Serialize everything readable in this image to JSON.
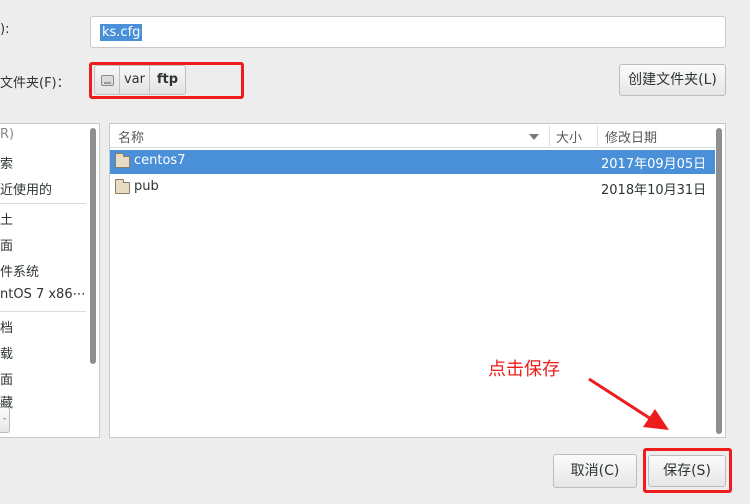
{
  "dialog": {
    "name_label": "):",
    "name_value": "ks.cfg",
    "folder_label": "文件夹(F)：",
    "path_segments": [
      "var",
      "ftp"
    ],
    "new_folder_label": "创建文件夹(L)"
  },
  "sidebar": {
    "items": [
      "R)",
      "索",
      "近使用的",
      "土",
      "面",
      "件系统",
      "ntOS 7 x86⋯",
      "档",
      "载",
      "面",
      "藏"
    ],
    "bottom_button": "-"
  },
  "file_list": {
    "columns": {
      "name": "名称",
      "size": "大小",
      "modified": "修改日期"
    },
    "rows": [
      {
        "name": "centos7",
        "date": "2017年09月05日",
        "selected": true
      },
      {
        "name": "pub",
        "date": "2018年10月31日",
        "selected": false
      }
    ]
  },
  "annotation": {
    "text": "点击保存",
    "color": "#ee1c1c"
  },
  "buttons": {
    "cancel": "取消(C)",
    "save": "保存(S)"
  },
  "colors": {
    "selection": "#4a90d9",
    "window_bg": "#ededed"
  }
}
